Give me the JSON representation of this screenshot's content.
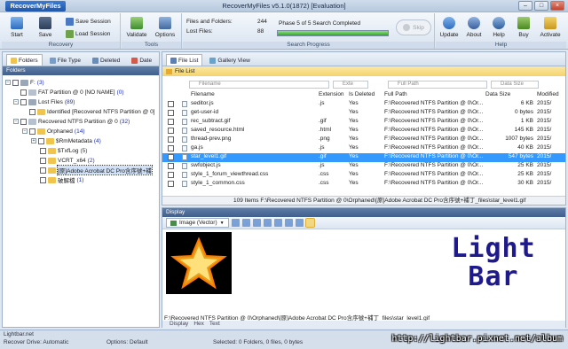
{
  "app": {
    "menu_button": "RecoverMyFiles",
    "title": "RecoverMyFiles v5.1.0(1872) [Evaluation]",
    "window_buttons": [
      "–",
      "□",
      "×"
    ]
  },
  "ribbon": {
    "recovery": {
      "label": "Recovery",
      "start": "Start",
      "save": "Save",
      "save_session": "Save Session",
      "load_session": "Load Session"
    },
    "tools": {
      "label": "Tools",
      "validate": "Validate",
      "options": "Options"
    },
    "search_progress": {
      "label": "Search Progress",
      "files_folders_label": "Files and Folders:",
      "files_folders_value": "244",
      "lost_files_label": "Lost Files:",
      "lost_files_value": "88",
      "phase_text": "Phase 5 of 5 Search Completed",
      "progress_fraction": 1.0,
      "skip": "Skip"
    },
    "help": {
      "label": "Help",
      "update": "Update",
      "about": "About",
      "help": "Help",
      "buy": "Buy",
      "activate": "Activate"
    }
  },
  "left": {
    "tabs": [
      "Folders",
      "File Type",
      "Deleted",
      "Date"
    ],
    "header": "Folders",
    "tree": [
      {
        "label": "F:",
        "count": "(3)"
      },
      {
        "label": "FAT Partition @ 0 [NO NAME]",
        "count": "(0)"
      },
      {
        "label": "Lost Files",
        "count": "(89)"
      },
      {
        "label": "Identified [Recovered NTFS Partition @ 0]",
        "count": ""
      },
      {
        "label": "Recovered NTFS Partition @ 0",
        "count": "(32)"
      },
      {
        "label": "Orphaned",
        "count": "(14)"
      },
      {
        "label": "$RmMetadata",
        "count": "(4)"
      },
      {
        "label": "$TxfLog",
        "count": "(5)"
      },
      {
        "label": "VCRT_x64",
        "count": "(2)"
      },
      {
        "label": "[原]Adobe Acrobat DC Pro含序號+補",
        "count": ""
      },
      {
        "label": "破解檔",
        "count": "(1)"
      }
    ]
  },
  "filelist": {
    "tabs": [
      "File List",
      "Gallery View"
    ],
    "header": "File List",
    "filters": [
      "Filename",
      "Exte",
      "Full Path",
      "Data Size"
    ],
    "columns": [
      "Filename",
      "Extension",
      "Is Deleted",
      "Full Path",
      "Data Size",
      "Modified"
    ],
    "rows": [
      [
        "seditor.js",
        ".js",
        "Yes",
        "F:\\Recovered NTFS Partition @ 0\\Or...",
        "6 KB",
        "2015/"
      ],
      [
        "get-user-id",
        "",
        "Yes",
        "F:\\Recovered NTFS Partition @ 0\\Or...",
        "0 bytes",
        "2015/"
      ],
      [
        "rec_subtract.gif",
        ".gif",
        "Yes",
        "F:\\Recovered NTFS Partition @ 0\\Or...",
        "1 KB",
        "2015/"
      ],
      [
        "saved_resource.html",
        ".html",
        "Yes",
        "F:\\Recovered NTFS Partition @ 0\\Or...",
        "145 KB",
        "2015/"
      ],
      [
        "thread-prev.png",
        ".png",
        "Yes",
        "F:\\Recovered NTFS Partition @ 0\\Or...",
        "1007 bytes",
        "2015/"
      ],
      [
        "ga.js",
        ".js",
        "Yes",
        "F:\\Recovered NTFS Partition @ 0\\Or...",
        "40 KB",
        "2015/"
      ],
      [
        "star_level1.gif",
        ".gif",
        "Yes",
        "F:\\Recovered NTFS Partition @ 0\\Or...",
        "547 bytes",
        "2015/"
      ],
      [
        "swfobject.js",
        ".js",
        "Yes",
        "F:\\Recovered NTFS Partition @ 0\\Or...",
        "25 KB",
        "2015/"
      ],
      [
        "style_1_forum_viewthread.css",
        ".css",
        "Yes",
        "F:\\Recovered NTFS Partition @ 0\\Or...",
        "25 KB",
        "2015/"
      ],
      [
        "style_1_common.css",
        ".css",
        "Yes",
        "F:\\Recovered NTFS Partition @ 0\\Or...",
        "30 KB",
        "2015/"
      ]
    ],
    "status": "109 Items  F:\\Recovered NTFS Partition @ 0\\Orphaned\\[原]Adobe Acrobat DC Pro含序號+補丁_files\\star_level1.gif"
  },
  "display": {
    "header": "Display",
    "view_mode": "Image (Vector)",
    "logo_line1": "Light",
    "logo_line2": "Bar",
    "path": "F:\\Recovered NTFS Partition @ 0\\Orphaned\\[原]Adobe Acrobat DC Pro含序號+補丁_files\\star_level1.gif",
    "bottom_tabs": [
      "Display",
      "Hex",
      "Text"
    ]
  },
  "statusbar": {
    "left_top": "Lightbar.net",
    "recover_drive": "Recover Drive: Automatic",
    "options": "Options: Default",
    "selected": "Selected: 0 Folders, 0 files, 0 bytes",
    "watermark": "http://lightbar.pixnet.net/album"
  }
}
